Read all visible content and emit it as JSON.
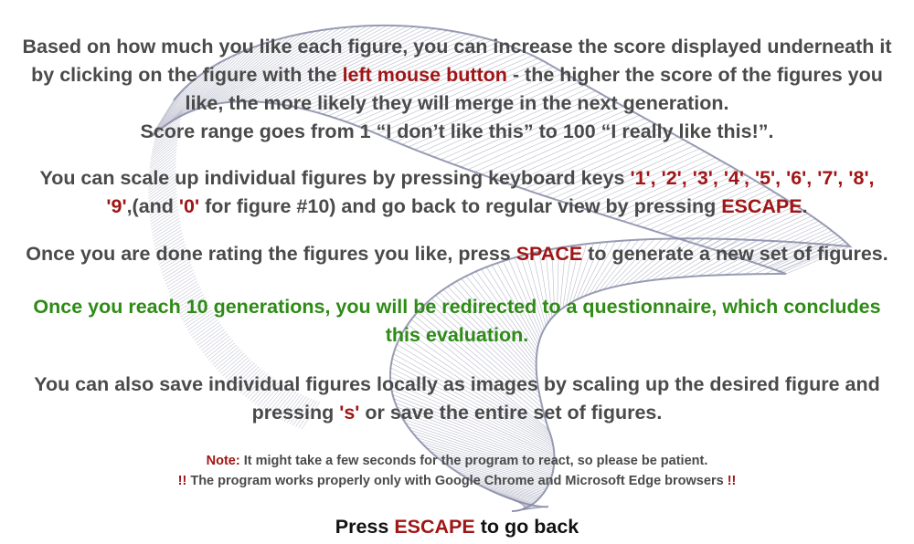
{
  "colors": {
    "text": "#4a4a4a",
    "highlight": "#a01515",
    "green": "#2e8b16",
    "figure_stroke": "#7f83a0"
  },
  "background": {
    "icon": "mobius-ribbon-figure"
  },
  "instructions": {
    "p1_line1": "Based on how much you like each figure, you can increase the score displayed underneath it",
    "p1_line2a": "by clicking on the figure with the ",
    "p1_line2_hl": "left mouse button",
    "p1_line2b": " - the higher the score of the figures you",
    "p1_line3": "like, the more likely they will merge in the next generation.",
    "p1_line4": "Score range goes from 1 “I don’t like this” to 100 “I really like this!”.",
    "p2_line1a": "You can scale up individual figures by pressing keyboard keys ",
    "p2_keys1": "'1', '2', '3', '4', '5', '6', '7', '8',",
    "p2_key9": "'9'",
    "p2_line2a": ",(and ",
    "p2_key0": "'0'",
    "p2_line2b": " for figure #10) and go back to regular view by pressing ",
    "p2_escape": "ESCAPE",
    "p2_line2c": ".",
    "p3a": "Once you are done rating the figures you like, press ",
    "p3_space": "SPACE",
    "p3b": " to generate a new set of figures.",
    "p4_line1": "Once you reach 10 generations, you will be redirected to a questionnaire, which concludes",
    "p4_line2": "this evaluation.",
    "p5_line1": "You can also save individual figures locally as images by scaling up the desired figure and",
    "p5_line2a": "pressing ",
    "p5_key_s": "'s'",
    "p5_line2b": " or save the entire set of figures.",
    "note_label": "Note:",
    "note_text": " It might take a few seconds for the program to react, so please be patient.",
    "warn_mark_left": "!!",
    "warn_text": " The program works properly only with Google Chrome and  Microsoft Edge browsers ",
    "warn_mark_right": "!!"
  },
  "footer": {
    "press": "Press ",
    "escape": "ESCAPE",
    "go_back": " to go back"
  }
}
